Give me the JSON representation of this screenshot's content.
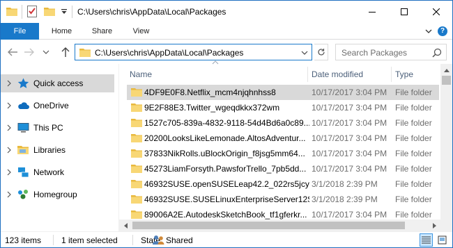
{
  "window": {
    "path_title": "C:\\Users\\chris\\AppData\\Local\\Packages",
    "minimize_icon": "minimize-icon",
    "maximize_icon": "maximize-icon",
    "close_icon": "close-icon"
  },
  "ribbon": {
    "tabs": [
      "File",
      "Home",
      "Share",
      "View"
    ],
    "help_label": "?"
  },
  "navigation": {
    "address": "C:\\Users\\chris\\AppData\\Local\\Packages",
    "search_placeholder": "Search Packages"
  },
  "nav_pane": {
    "items": [
      {
        "label": "Quick access",
        "icon": "star-icon"
      },
      {
        "label": "OneDrive",
        "icon": "cloud-icon"
      },
      {
        "label": "This PC",
        "icon": "computer-icon"
      },
      {
        "label": "Libraries",
        "icon": "library-icon"
      },
      {
        "label": "Network",
        "icon": "network-icon"
      },
      {
        "label": "Homegroup",
        "icon": "homegroup-icon"
      }
    ]
  },
  "file_list": {
    "columns": [
      "Name",
      "Date modified",
      "Type"
    ],
    "rows": [
      {
        "name": "4DF9E0F8.Netflix_mcm4njqhnhss8",
        "date": "10/17/2017 3:04 PM",
        "type": "File folder"
      },
      {
        "name": "9E2F88E3.Twitter_wgeqdkkx372wm",
        "date": "10/17/2017 3:04 PM",
        "type": "File folder"
      },
      {
        "name": "1527c705-839a-4832-9118-54d4Bd6a0c89...",
        "date": "10/17/2017 3:04 PM",
        "type": "File folder"
      },
      {
        "name": "20200LooksLikeLemonade.AltosAdventur...",
        "date": "10/17/2017 3:04 PM",
        "type": "File folder"
      },
      {
        "name": "37833NikRolls.uBlockOrigin_f8jsg5mm64...",
        "date": "10/17/2017 3:04 PM",
        "type": "File folder"
      },
      {
        "name": "45273LiamForsyth.PawsforTrello_7pb5dd...",
        "date": "10/17/2017 3:04 PM",
        "type": "File folder"
      },
      {
        "name": "46932SUSE.openSUSELeap42.2_022rs5jcy...",
        "date": "3/1/2018 2:39 PM",
        "type": "File folder"
      },
      {
        "name": "46932SUSE.SUSELinuxEnterpriseServer12S...",
        "date": "3/1/2018 2:39 PM",
        "type": "File folder"
      },
      {
        "name": "89006A2E.AutodeskSketchBook_tf1gferkr...",
        "date": "10/17/2017 3:04 PM",
        "type": "File folder"
      }
    ]
  },
  "status": {
    "item_count": "123 items",
    "selected": "1 item selected",
    "state_label": "State:",
    "state_value": "Shared"
  },
  "colors": {
    "accent": "#1979ca",
    "selection": "#d9d9d9",
    "folder": "#f8d775"
  }
}
